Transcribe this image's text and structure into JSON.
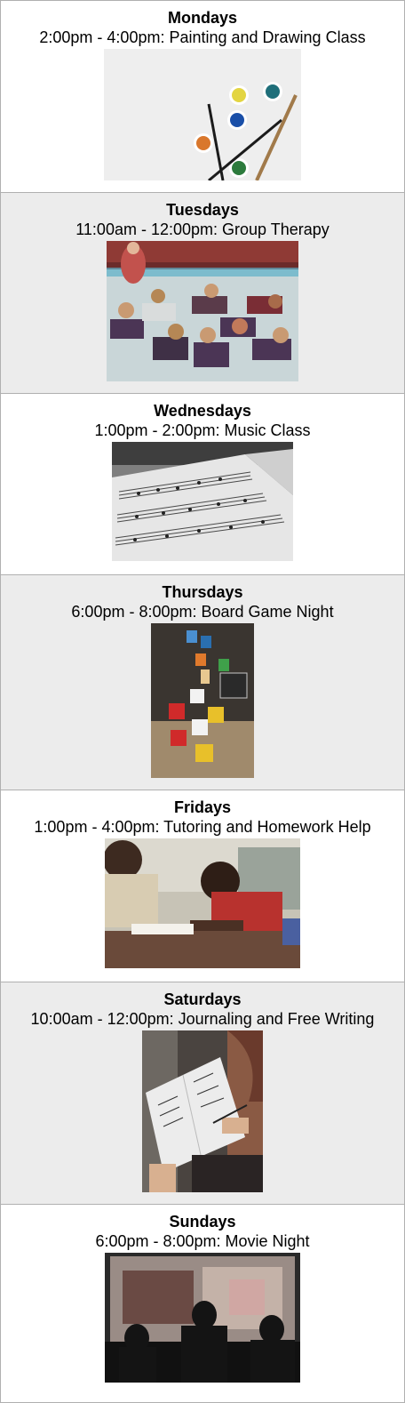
{
  "schedule": [
    {
      "day": "Mondays",
      "activity": "2:00pm - 4:00pm: Painting and Drawing Class",
      "image": "paint-palette-brushes-photo"
    },
    {
      "day": "Tuesdays",
      "activity": "11:00am - 12:00pm: Group Therapy",
      "image": "children-circle-floor-photo"
    },
    {
      "day": "Wednesdays",
      "activity": "1:00pm - 2:00pm: Music Class",
      "image": "sheet-music-book-photo"
    },
    {
      "day": "Thursdays",
      "activity": "6:00pm - 8:00pm: Board Game Night",
      "image": "board-game-dice-photo"
    },
    {
      "day": "Fridays",
      "activity": "1:00pm - 4:00pm: Tutoring and Homework Help",
      "image": "students-writing-photo"
    },
    {
      "day": "Saturdays",
      "activity": "10:00am - 12:00pm: Journaling and Free Writing",
      "image": "journal-writing-photo"
    },
    {
      "day": "Sundays",
      "activity": "6:00pm - 8:00pm: Movie Night",
      "image": "movie-audience-screen-photo"
    }
  ]
}
